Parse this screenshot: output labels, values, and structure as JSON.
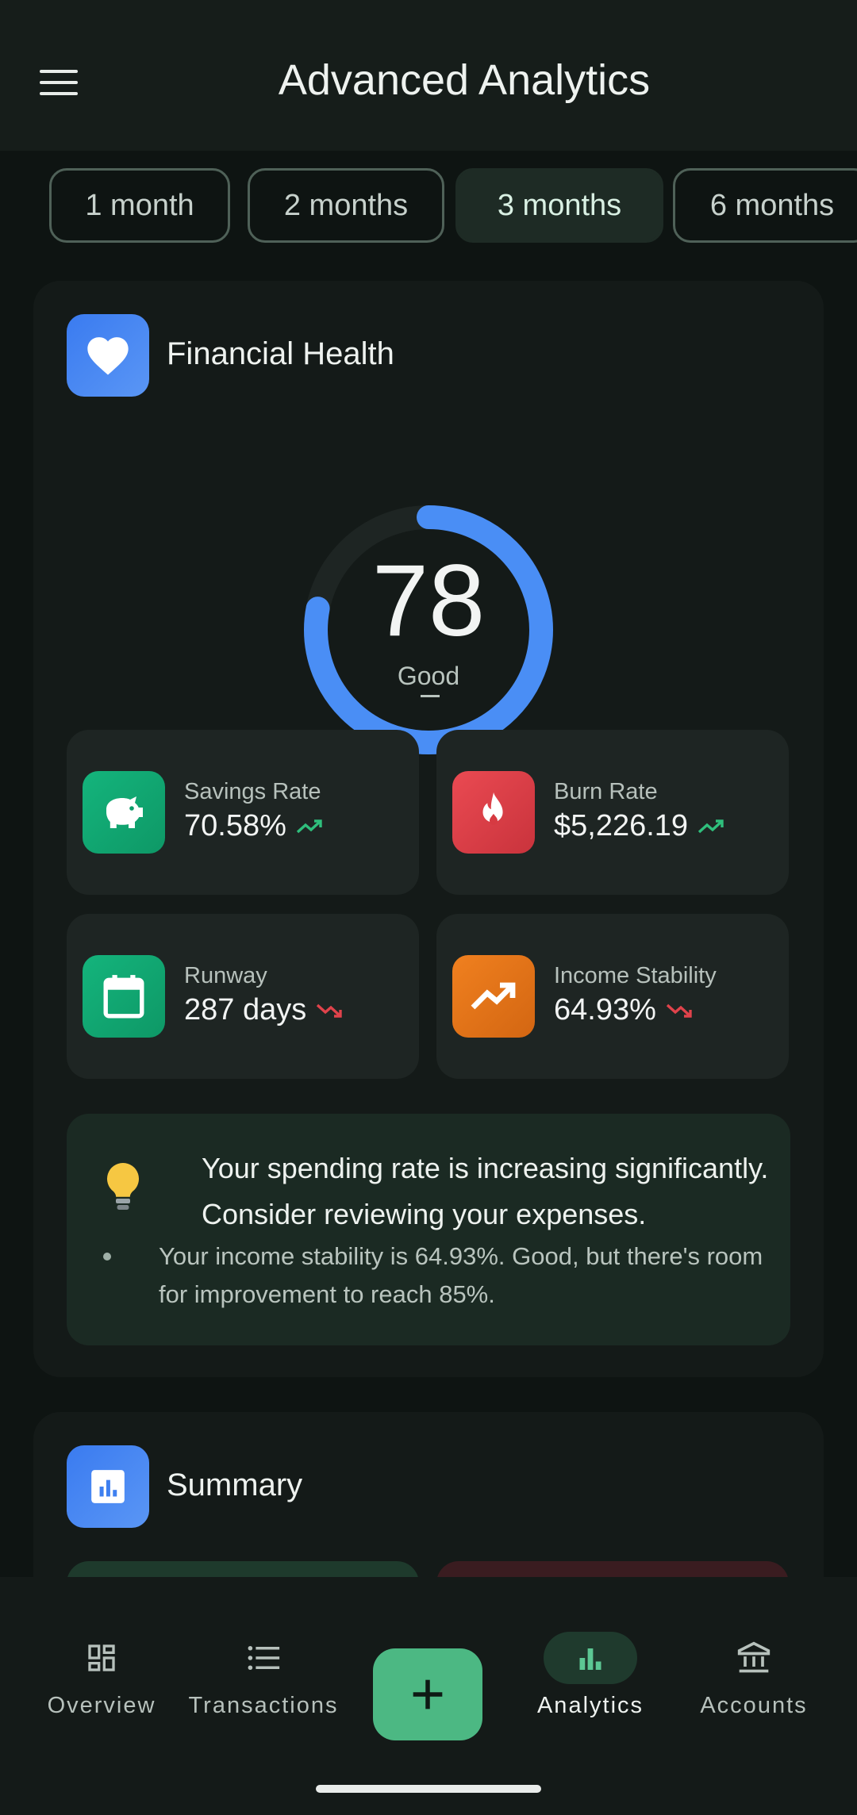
{
  "app_bar": {
    "title": "Advanced Analytics"
  },
  "periods": [
    {
      "label": "1 month",
      "active": false
    },
    {
      "label": "2 months",
      "active": false
    },
    {
      "label": "3 months",
      "active": true
    },
    {
      "label": "6 months",
      "active": false
    }
  ],
  "health": {
    "title": "Financial Health",
    "score": "78",
    "score_value": 78,
    "score_max": 100,
    "rating": "Good",
    "metrics": [
      {
        "label": "Savings Rate",
        "value": "70.58%",
        "trend": "up",
        "icon": "piggy-bank-icon",
        "color": "#16a874"
      },
      {
        "label": "Burn Rate",
        "value": "$5,226.19",
        "trend": "up",
        "icon": "fire-icon",
        "color": "#e0434b"
      },
      {
        "label": "Runway",
        "value": "287 days",
        "trend": "down",
        "icon": "calendar-icon",
        "color": "#16a874"
      },
      {
        "label": "Income Stability",
        "value": "64.93%",
        "trend": "down",
        "icon": "trending-up-icon",
        "color": "#ee7a1d"
      }
    ],
    "insight": {
      "main": "Your spending rate is increasing significantly. Consider reviewing your expenses.",
      "detail": "Your income stability is 64.93%. Good, but there's room for improvement to reach 85%."
    }
  },
  "summary": {
    "title": "Summary"
  },
  "nav": {
    "items": [
      {
        "label": "Overview",
        "icon": "dashboard-icon",
        "active": false
      },
      {
        "label": "Transactions",
        "icon": "list-icon",
        "active": false
      },
      {
        "label": "Analytics",
        "icon": "bar-chart-icon",
        "active": true
      },
      {
        "label": "Accounts",
        "icon": "bank-icon",
        "active": false
      }
    ],
    "fab_icon": "plus-icon"
  },
  "colors": {
    "background": "#0e1412",
    "accent_green": "#4cb883",
    "gauge_blue": "#4a8ef5",
    "trend_up": "#2fbf7c",
    "trend_down": "#e0434b"
  }
}
